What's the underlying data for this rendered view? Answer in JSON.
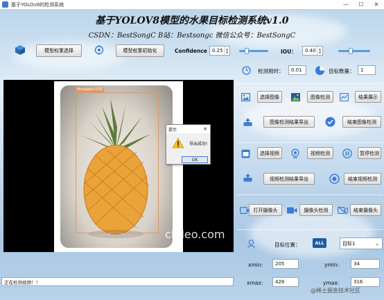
{
  "window": {
    "title": "基于YOLOv8的检测系统",
    "minimize": "—",
    "maximize": "☐",
    "close": "✕"
  },
  "header": {
    "title": "基于YOLOV8模型的水果目标检测系统v1.0",
    "subtitle": "CSDN：BestSongC   B站：Bestsongc   微信公众号：BestSongC"
  },
  "toolbar": {
    "select_weights": "模型权重选择",
    "init_weights": "模型权重初始化",
    "confidence_label": "Confidence",
    "confidence_value": "0.25",
    "confidence_level": 0.25,
    "iou_label": "IOU：",
    "iou_value": "0.40",
    "iou_level": 0.4
  },
  "stats": {
    "time_label": "检测用时：",
    "time_value": "0.01",
    "count_label": "目标数量：",
    "count_value": "1"
  },
  "image_section": {
    "select_image": "选择图像",
    "detect_image": "图像检测",
    "show_result": "结果展示",
    "export_image": "图像检测结果导出",
    "stop_image": "结束图像检测"
  },
  "video_section": {
    "select_video": "选择视频",
    "detect_video": "视频检测",
    "pause_detect": "暂停检测",
    "export_video": "视频检测结果导出",
    "stop_video": "结束视频检测"
  },
  "camera_section": {
    "open_camera": "打开摄像头",
    "detect_camera": "摄像头检测",
    "close_camera": "结束摄像头"
  },
  "target": {
    "position_label": "目标位置：",
    "all_badge": "ALL",
    "selected_target": "目标1",
    "xmin_label": "xmin:",
    "xmin_value": "205",
    "ymin_label": "ymin:",
    "ymin_value": "34",
    "xmax_label": "xmax:",
    "xmax_value": "428",
    "ymax_label": "ymax:",
    "ymax_value": "316"
  },
  "viewer": {
    "detection_label": "Pineapple 0.85",
    "watermark": "clideo.com"
  },
  "dialog": {
    "title": "提示",
    "message": "导出成功!",
    "ok": "OK",
    "close": "✕"
  },
  "status": {
    "text": "正在检测视频！！"
  },
  "footer_watermark": "@稀土掘金技术社区",
  "colors": {
    "accent": "#3a7bd5",
    "slider": "#5b9bd5",
    "box": "#d89a6a"
  }
}
